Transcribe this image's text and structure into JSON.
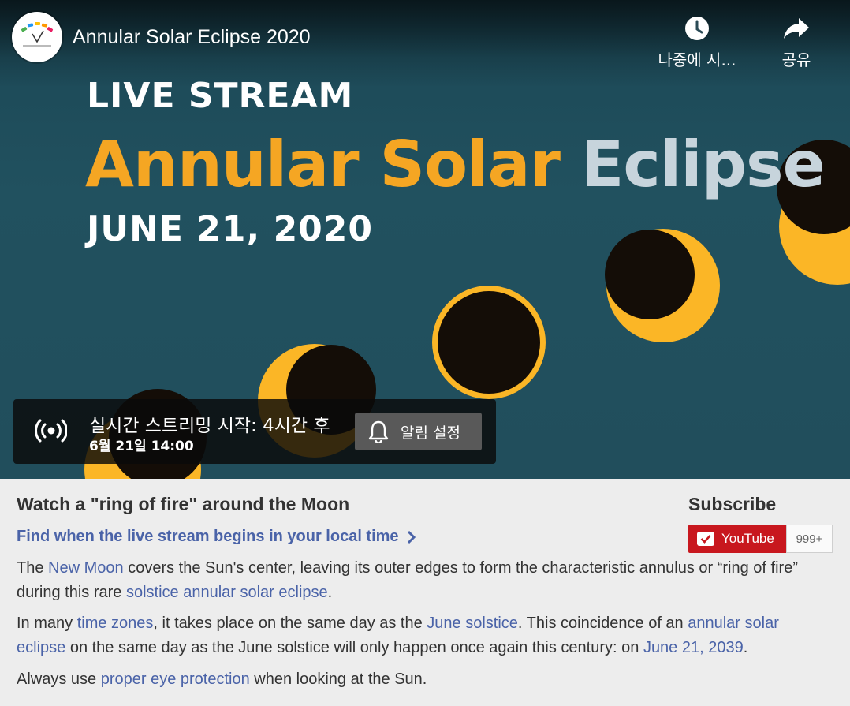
{
  "player": {
    "title": "Annular Solar Eclipse 2020",
    "actions": {
      "watch_later_label": "나중에 시...",
      "share_label": "공유"
    },
    "thumbnail": {
      "line1": "LIVE STREAM",
      "title_part1": "Annular Solar",
      "title_part2": "Eclipse",
      "date": "JUNE 21, 2020",
      "colors": {
        "background": "#21505f",
        "sun": "#fbb626",
        "moon": "#140d07",
        "accent": "#f5a623",
        "title_gray": "#c7d4dc"
      }
    },
    "live_banner": {
      "status": "실시간 스트리밍 시작: 4시간 후",
      "datetime": "6월 21일 14:00",
      "reminder_label": "알림 설정"
    }
  },
  "info": {
    "heading": "Watch a \"ring of fire\" around the Moon",
    "local_time_link": "Find when the live stream begins in your local time",
    "paragraphs": {
      "p1_a": "The ",
      "p1_link1": "New Moon",
      "p1_b": " covers the Sun's center, leaving its outer edges to form the characteristic annulus or “ring of fire” during this rare ",
      "p1_link2": "solstice annular solar eclipse",
      "p1_c": ".",
      "p2_a": "In many ",
      "p2_link1": "time zones",
      "p2_b": ", it takes place on the same day as the ",
      "p2_link2": "June solstice",
      "p2_c": ". This coincidence of an ",
      "p2_link3": "annular solar eclipse",
      "p2_d": " on the same day as the June solstice will only happen once again this century: on ",
      "p2_link4": "June 21, 2039",
      "p2_e": ".",
      "p3_a": "Always use ",
      "p3_link1": "proper eye protection",
      "p3_b": " when looking at the Sun."
    },
    "link_color": "#4a63a8"
  },
  "subscribe": {
    "label": "Subscribe",
    "button_label": "YouTube",
    "count": "999+",
    "button_color": "#c8171e"
  }
}
